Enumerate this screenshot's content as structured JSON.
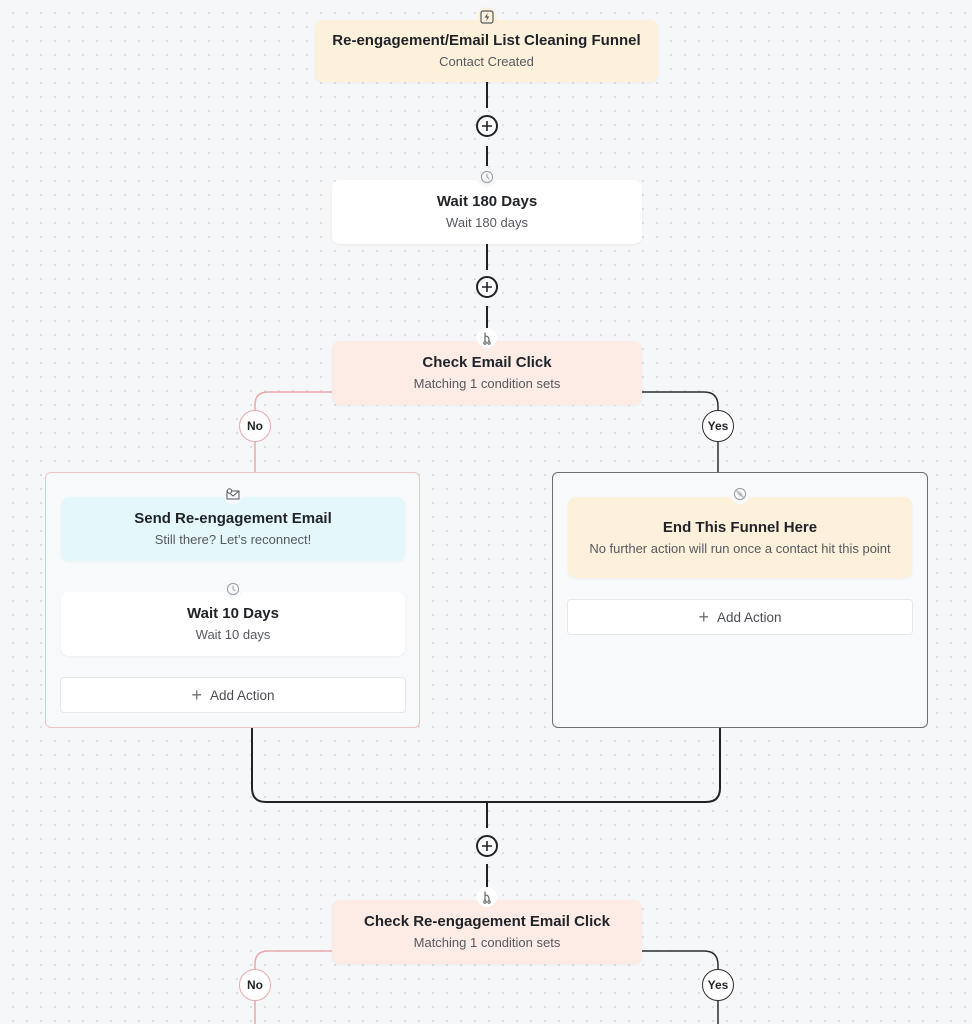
{
  "canvas": {
    "colors": {
      "background": "#f6f7f8",
      "trigger": "#fdf1dc",
      "wait": "#ffffff",
      "condition": "#fdebe6",
      "email": "#e4f7fb",
      "end": "#fdf1dc",
      "no_branch": "#e8a9ab",
      "yes_branch": "#2a2d31"
    }
  },
  "trigger": {
    "icon": "lightning-icon",
    "title": "Re-engagement/Email List Cleaning Funnel",
    "subtitle": "Contact Created"
  },
  "wait_180": {
    "icon": "clock-icon",
    "title": "Wait 180 Days",
    "subtitle": "Wait 180 days"
  },
  "check_email_click": {
    "icon": "branch-icon",
    "title": "Check Email Click",
    "subtitle": "Matching 1 condition sets",
    "no_label": "No",
    "yes_label": "Yes"
  },
  "no_branch": {
    "send_email": {
      "icon": "email-icon",
      "title": "Send Re-engagement Email",
      "subtitle": "Still there? Let’s reconnect!"
    },
    "wait_10": {
      "icon": "clock-icon",
      "title": "Wait 10 Days",
      "subtitle": "Wait 10 days"
    },
    "add_action": "Add Action"
  },
  "yes_branch": {
    "end_funnel": {
      "icon": "stop-icon",
      "title": "End This Funnel Here",
      "subtitle": "No further action will run once a contact hit this point"
    },
    "add_action": "Add Action"
  },
  "check_reengagement_click": {
    "icon": "branch-icon",
    "title": "Check Re-engagement Email Click",
    "subtitle": "Matching 1 condition sets",
    "no_label": "No",
    "yes_label": "Yes"
  }
}
